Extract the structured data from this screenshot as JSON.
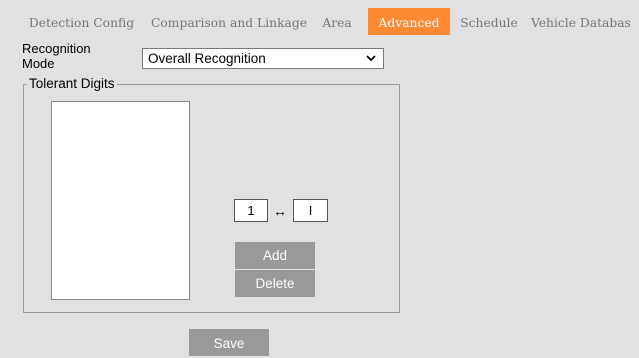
{
  "tabs": [
    {
      "label": "Detection Config",
      "active": false
    },
    {
      "label": "Comparison and Linkage",
      "active": false
    },
    {
      "label": "Area",
      "active": false
    },
    {
      "label": "Advanced",
      "active": true
    },
    {
      "label": "Schedule",
      "active": false
    },
    {
      "label": "Vehicle Databas",
      "active": false
    }
  ],
  "form": {
    "recognition_mode_label_line1": "Recognition",
    "recognition_mode_label_line2": "Mode",
    "recognition_mode_value": "Overall Recognition",
    "tolerant_digits_legend": "Tolerant Digits",
    "tolerant_digits_list": [],
    "char_from": "1",
    "char_to": "I",
    "mapping_symbol": "↔",
    "add_label": "Add",
    "delete_label": "Delete",
    "save_label": "Save"
  },
  "colors": {
    "background": "#e1e1e1",
    "active_tab": "#ff8a33",
    "button": "#999999"
  },
  "icons": {
    "select_arrow": "chevron-down-icon",
    "mapping": "left-right-arrow-icon"
  }
}
